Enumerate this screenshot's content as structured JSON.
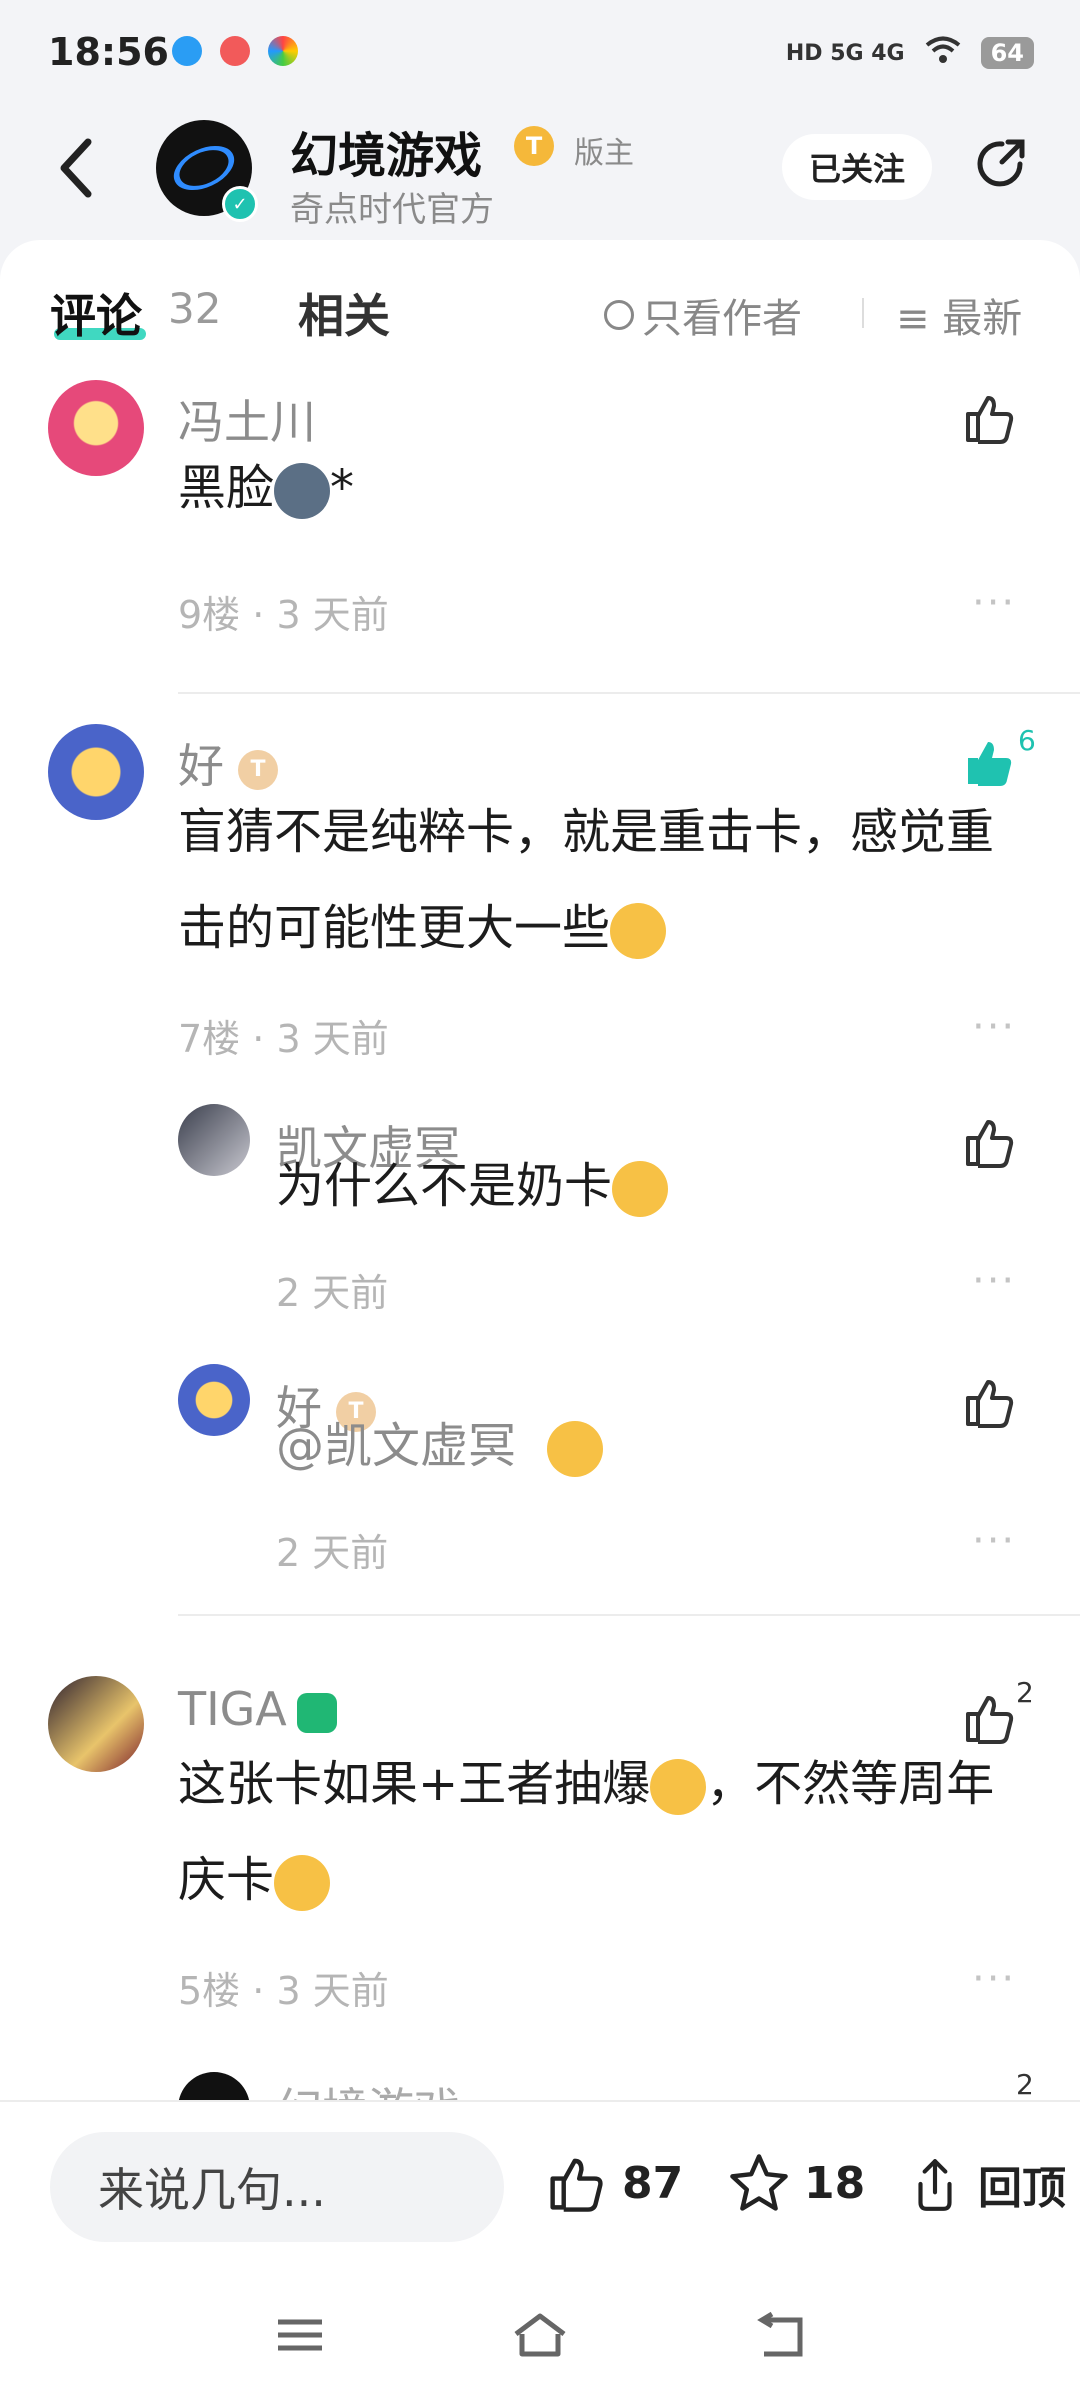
{
  "status_bar": {
    "time": "18:56",
    "icons": [
      "qq-icon",
      "map-pin-icon",
      "color-wheel-icon"
    ],
    "network": "HD 5G 4G",
    "battery": "64"
  },
  "header": {
    "back_icon": "back-arrow-icon",
    "title": "幻境游戏",
    "level_badge": "T",
    "role": "版主",
    "subtitle": "奇点时代官方",
    "follow_label": "已关注",
    "share_icon": "share-icon"
  },
  "tabs": {
    "comments_label": "评论",
    "comments_count": "32",
    "related_label": "相关",
    "only_author_label": "只看作者",
    "sort_label": "最新"
  },
  "comments": [
    {
      "name": "冯土川",
      "text": "黑脸",
      "text_suffix": "*",
      "floor": "9楼",
      "time": "3 天前",
      "likes": ""
    },
    {
      "name": "好",
      "level": "T",
      "text": "盲猜不是纯粹卡，就是重击卡，感觉重击的可能性更大一些",
      "floor": "7楼",
      "time": "3 天前",
      "likes": "6",
      "replies": [
        {
          "name": "凯文虚冥",
          "text": "为什么不是奶卡",
          "time": "2 天前"
        },
        {
          "name": "好",
          "level": "T",
          "text": "@凯文虚冥",
          "time": "2 天前"
        }
      ]
    },
    {
      "name": "TIGA",
      "text": "这张卡如果+王者抽爆",
      "text_part2": "，不然等周年庆卡",
      "floor": "5楼",
      "time": "3 天前",
      "likes": "2"
    },
    {
      "name": "幻境游戏",
      "likes": "2"
    }
  ],
  "bottom_bar": {
    "input_placeholder": "来说几句...",
    "like_count": "87",
    "star_count": "18",
    "top_label": "回顶"
  },
  "colors": {
    "accent": "#1fc2b0",
    "text_muted": "#8c8c8c",
    "background": "#f3f4f7"
  }
}
